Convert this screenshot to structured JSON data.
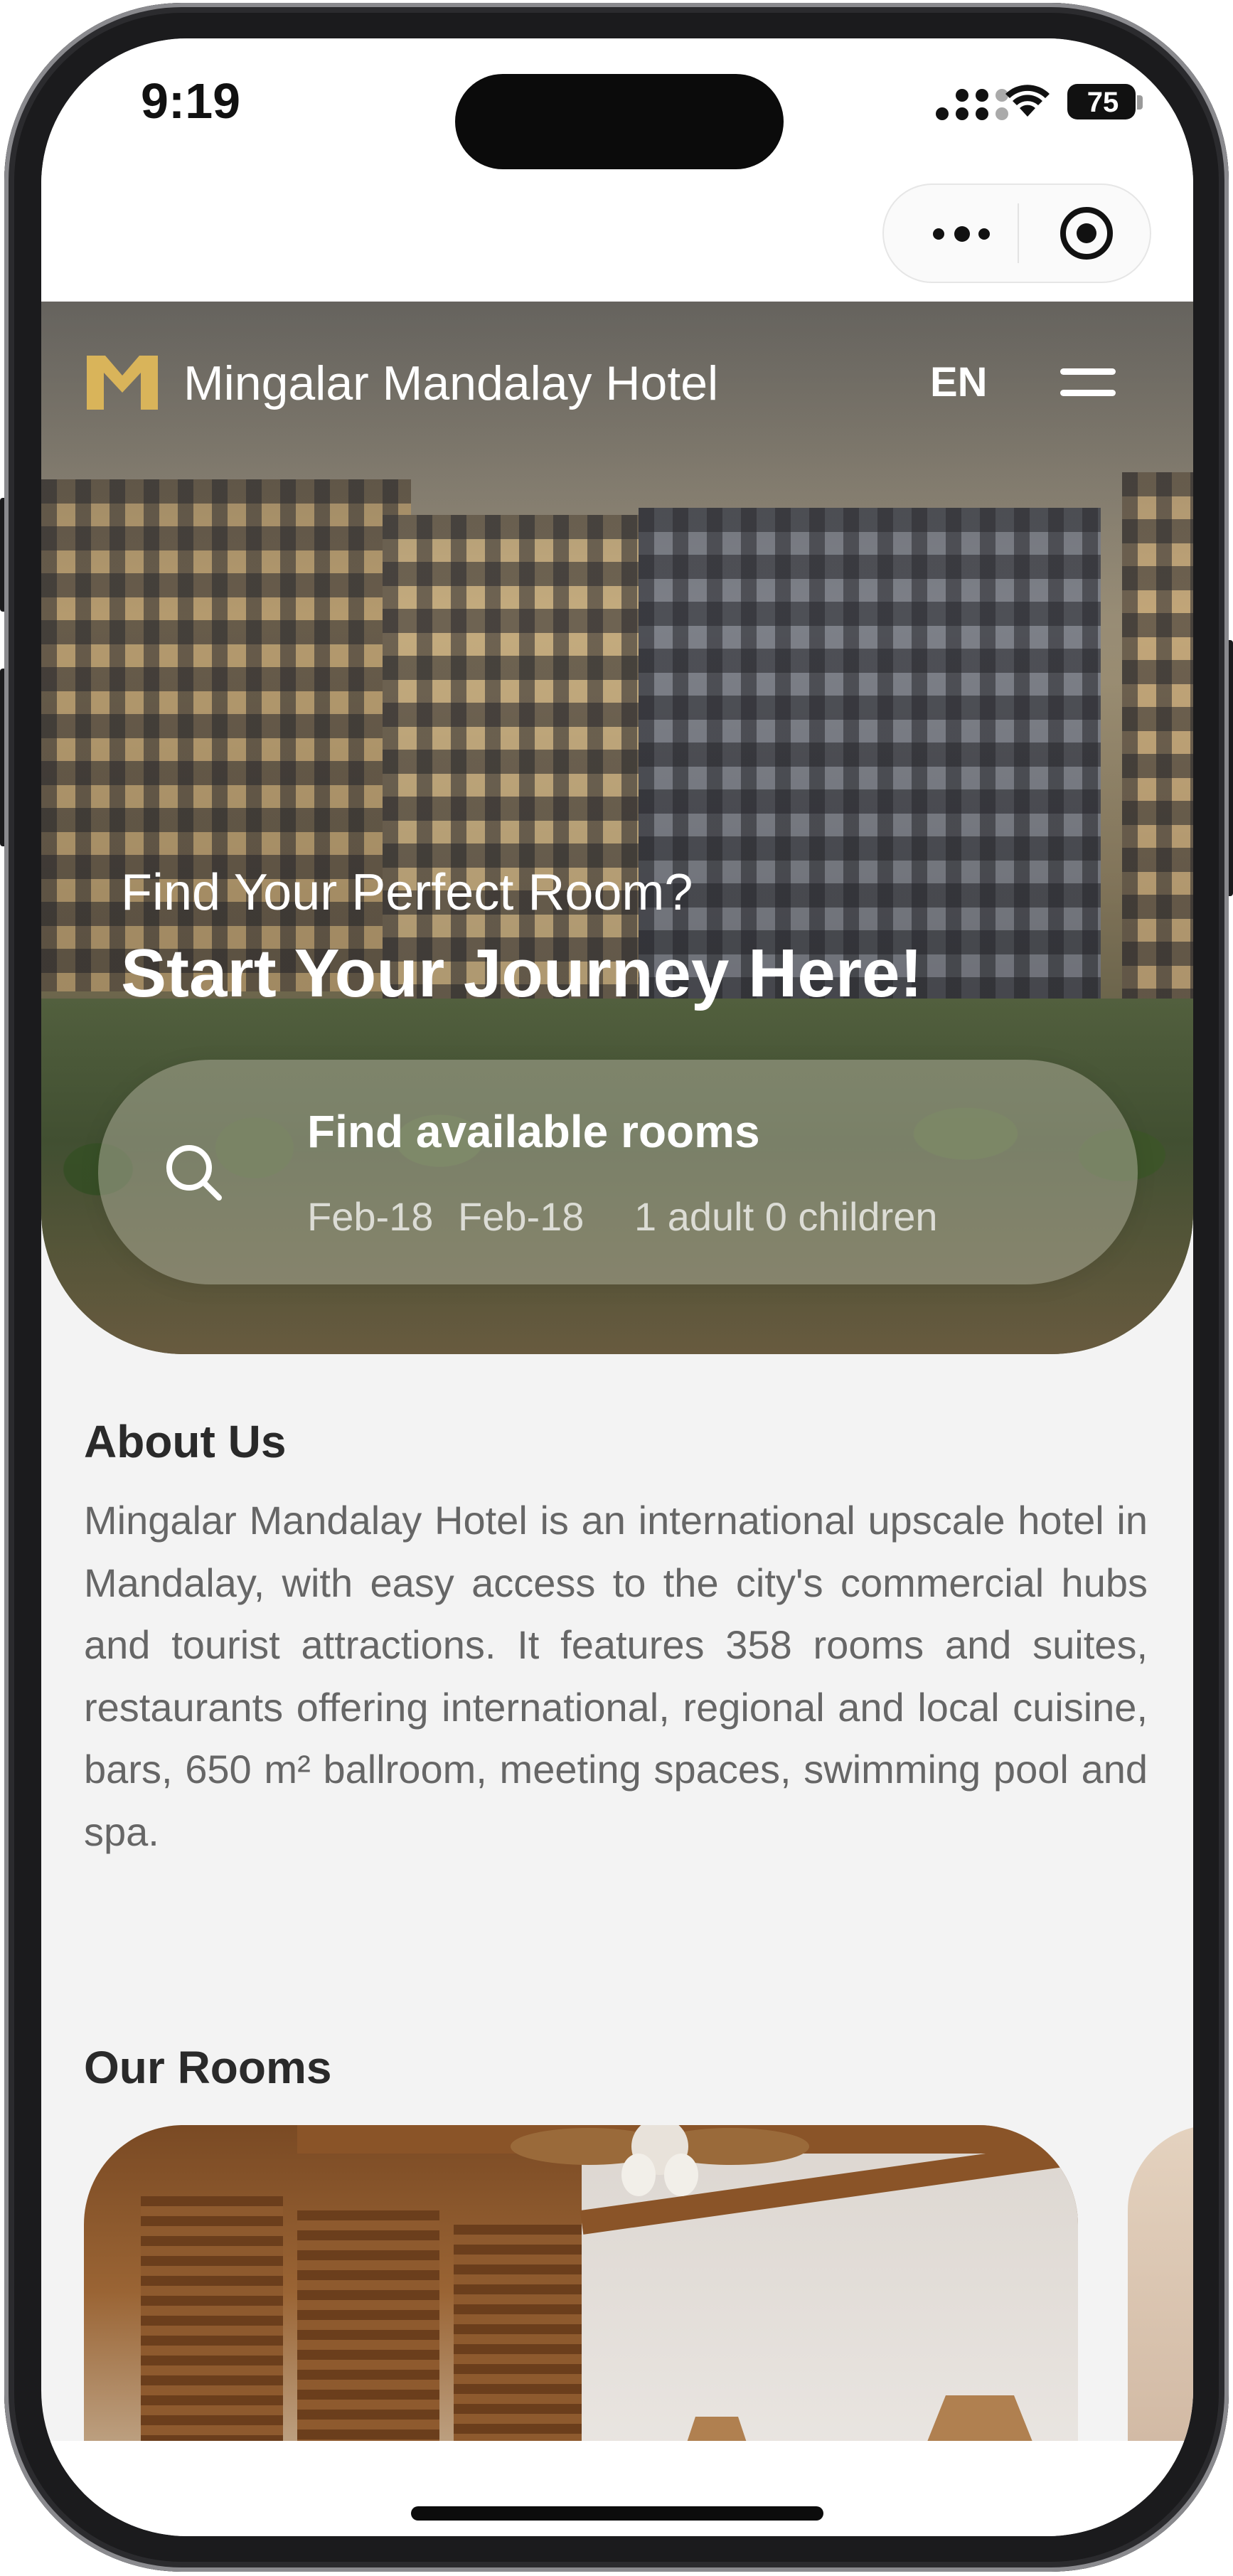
{
  "status_bar": {
    "time": "9:19",
    "battery": "75"
  },
  "mini_program": {
    "more_icon": "more-dots-icon",
    "close_icon": "target-close-icon"
  },
  "header": {
    "brand_name": "Mingalar Mandalay Hotel",
    "language": "EN",
    "menu_icon": "hamburger-menu-icon",
    "logo_color": "#d9b45a"
  },
  "hero": {
    "subtitle": "Find Your Perfect Room?",
    "headline": "Start Your Journey Here!"
  },
  "search": {
    "title": "Find available rooms",
    "check_in": "Feb-18",
    "check_out": "Feb-18",
    "guests": "1 adult 0 children"
  },
  "about": {
    "title": "About Us",
    "text": "Mingalar Mandalay Hotel is an international upscale hotel in Mandalay, with easy access to the city's commercial hubs and tourist attractions. It features 358 rooms and suites, restaurants offering international, regional and local cuisine, bars, 650 m² ballroom, meeting spaces, swimming pool and spa."
  },
  "rooms": {
    "title": "Our Rooms"
  }
}
